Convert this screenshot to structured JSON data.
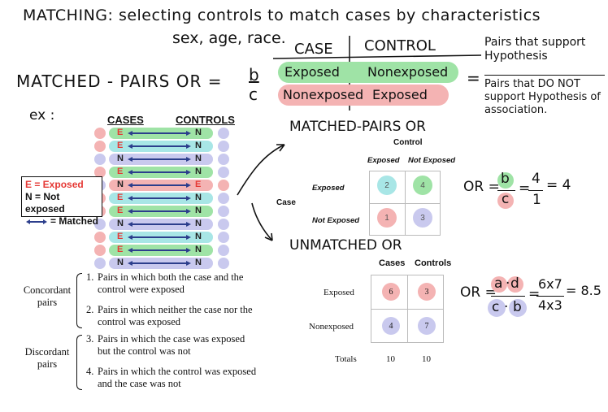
{
  "notes": {
    "title": "MATCHING: selecting controls to match cases by characteristics",
    "subtitle": "sex, age, race.",
    "matched_pairs_or": "MATCHED - PAIRS OR =",
    "or_num": "b",
    "or_den": "c",
    "case_header": "CASE",
    "control_header": "CONTROL",
    "row1_case": "Exposed",
    "row1_ctrl": "Nonexposed",
    "row2_case": "Nonexposed",
    "row2_ctrl": "Exposed",
    "equals": "=",
    "side_support": "Pairs that support Hypothesis",
    "side_not_support": "Pairs that DO NOT support Hypothesis of association.",
    "ex_label": "ex :",
    "matched_pairs_heading": "MATCHED-PAIRS OR",
    "unmatched_heading": "UNMATCHED OR",
    "or1_text": "OR =",
    "or1_b": "b",
    "or1_c": "c",
    "or1_eq": "=",
    "or1_4": "4",
    "or1_1": "1",
    "or1_result": "= 4",
    "or2_text": "OR =",
    "or2_a": "a",
    "or2_d": "d",
    "or2_c": "c",
    "or2_b": "b",
    "or2_eq": "=",
    "or2_num": "6x7",
    "or2_den": "4x3",
    "or2_result": "= 8.5"
  },
  "pairs_diagram": {
    "cases_header": "CASES",
    "controls_header": "CONTROLS",
    "legend": {
      "exposed": "E = Exposed",
      "not_exposed": "N = Not exposed",
      "matched": "= Matched"
    },
    "rows": [
      {
        "case": "E",
        "control": "N"
      },
      {
        "case": "E",
        "control": "N"
      },
      {
        "case": "N",
        "control": "N"
      },
      {
        "case": "E",
        "control": "N"
      },
      {
        "case": "N",
        "control": "E"
      },
      {
        "case": "E",
        "control": "N"
      },
      {
        "case": "E",
        "control": "N"
      },
      {
        "case": "N",
        "control": "N"
      },
      {
        "case": "E",
        "control": "N"
      },
      {
        "case": "E",
        "control": "N"
      },
      {
        "case": "N",
        "control": "N"
      }
    ]
  },
  "definitions": {
    "concordant_label": "Concordant pairs",
    "concordant_1_num": "1.",
    "concordant_1": "Pairs in which both the case and the control were exposed",
    "concordant_2_num": "2.",
    "concordant_2": "Pairs in which neither the case nor the control was exposed",
    "discordant_label": "Discordant pairs",
    "discordant_3_num": "3.",
    "discordant_3": "Pairs in which the case was exposed but the control was not",
    "discordant_4_num": "4.",
    "discordant_4": "Pairs in which the control was exposed and the case was not"
  },
  "matched_table": {
    "control_title": "Control",
    "col_exposed": "Exposed",
    "col_not_exposed": "Not Exposed",
    "row_title": "Case",
    "row_exposed": "Exposed",
    "row_not_exposed": "Not Exposed",
    "cells": [
      "2",
      "4",
      "1",
      "3"
    ]
  },
  "unmatched_table": {
    "col_cases": "Cases",
    "col_controls": "Controls",
    "row_exposed": "Exposed",
    "row_nonexposed": "Nonexposed",
    "row_totals": "Totals",
    "cells": [
      "6",
      "3",
      "4",
      "7"
    ],
    "totals": [
      "10",
      "10"
    ]
  },
  "colors": {
    "green": "#9fe3a6",
    "pink": "#f4b3b3",
    "lavender": "#c9c9ee",
    "teal": "#a8e6e6",
    "arrow_blue": "#2c3e8c",
    "exposed_red": "#e53935"
  }
}
